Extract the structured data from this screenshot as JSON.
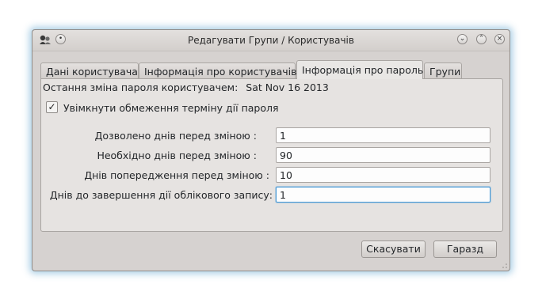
{
  "window": {
    "title": "Редагувати Групи / Користувачів"
  },
  "titlebar_buttons": {
    "menu_icon": "app-icon",
    "minimize": "⌄",
    "maximize": "⌃",
    "close": "×",
    "pin": "•"
  },
  "tabs": [
    {
      "label": "Дані користувача",
      "active": false
    },
    {
      "label": "Інформація про користувачів",
      "active": false
    },
    {
      "label": "Інформація про пароль",
      "active": true
    },
    {
      "label": "Групи",
      "active": false
    }
  ],
  "password": {
    "last_change_label": "Остання зміна пароля користувачем:",
    "last_change_value": "Sat Nov 16 2013",
    "enable_expiry_label": "Увімкнути обмеження терміну дії пароля",
    "enable_expiry_checked": true,
    "fields": [
      {
        "label": "Дозволено днів перед зміною :",
        "value": "1"
      },
      {
        "label": "Необхідно днів перед зміною :",
        "value": "90"
      },
      {
        "label": "Днів попередження перед зміною :",
        "value": "10"
      },
      {
        "label": "Днів до завершення дії облікового запису:",
        "value": "1"
      }
    ]
  },
  "buttons": {
    "cancel": "Скасувати",
    "ok": "Гаразд"
  },
  "colors": {
    "accent": "#4a9ad6",
    "window_bg": "#d6d2d0",
    "panel_bg": "#e6e3e1"
  }
}
